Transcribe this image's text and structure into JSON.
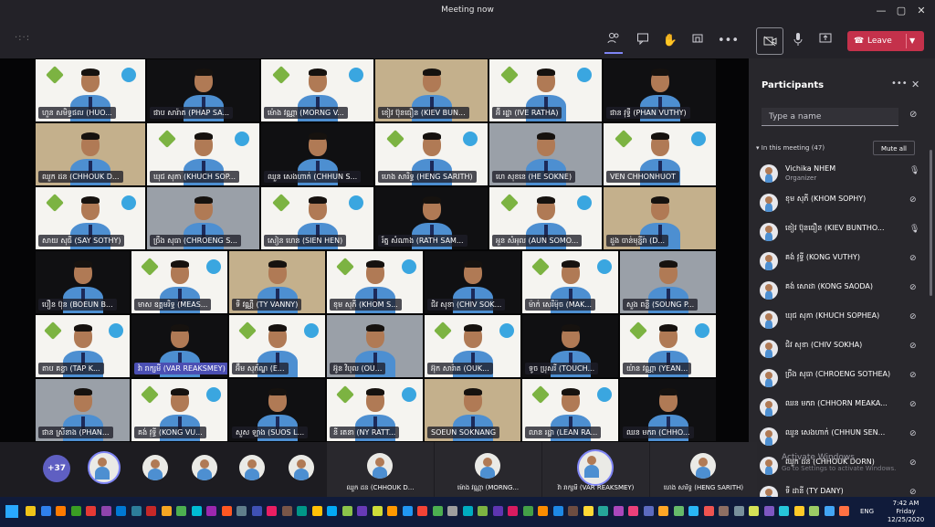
{
  "window": {
    "title": "Meeting now"
  },
  "toolbar": {
    "leave_label": "Leave"
  },
  "panel": {
    "title": "Participants",
    "search_placeholder": "Type a name",
    "section_label": "In this meeting (47)",
    "mute_all_label": "Mute all",
    "participants": [
      {
        "name": "Vichika NHEM",
        "role": "Organizer"
      },
      {
        "name": "ខុម សុភី (KHOM SOPHY)"
      },
      {
        "name": "ខៀវ ប៊ុនធឿន (KIEV BUNTHO..."
      },
      {
        "name": "គង់ វុទ្ធី (KONG VUTHY)"
      },
      {
        "name": "គង់ សោដា (KONG SAODA)"
      },
      {
        "name": "ឃុជ សុភា (KHUCH SOPHEA)"
      },
      {
        "name": "ជិវ សុខា (CHIV SOKHA)"
      },
      {
        "name": "ច្រឹង សុធា (CHROENG SOTHEA)"
      },
      {
        "name": "ឈន មករា (CHHORN MEAKA..."
      },
      {
        "name": "ឈួន សេងហាក់ (CHHUN SEN..."
      },
      {
        "name": "ឈួក ដន (CHHOUK DORN)"
      },
      {
        "name": "ទី ដានី (TY DANY)"
      }
    ]
  },
  "grid": {
    "tiles": [
      "ហួន សមិទ្ធផល (HUO...",
      "ផាប សារ៉ាត (PHAP SA...",
      "ម៉ោង វណ្ណា (MORNG V...",
      "ខៀវ ប៊ុនធឿន (KIEV BUN...",
      "អ៊ី រដ្ឋា (IVE RATHA)",
      "ផាន វុទ្ធី (PHAN VUTHY)",
      "ឈួក ដន (CHHOUK D...",
      "ឃុជ សុភា (KHUCH SOP...",
      "ឈួន សេងហាក់ (CHHUN S...",
      "ហេង សារិទ្ធ (HENG SARITH)",
      "ហេ សុខនេ (HE SOKNE)",
      "VEN CHHONHUOT",
      "សាយ សុធី (SAY SOTHY)",
      "ច្រឹង សុធា (CHROENG S...",
      "សៀន ហេន (SIEN HEN)",
      "រ័ត្ន សំណាង (RATH SAM...",
      "អួន សំអុល (AUN SOMO...",
      "ដួង ចាន់មុន្នីរ៉ា (D...",
      "បឿន ប៊ុន (BOEUN B...",
      "មាស ឧត្តមរិទ្ធ (MEAS...",
      "ទី វណ្ណី (TY VANNY)",
      "ខុម សុភី (KHOM S...",
      "ជិវ សុខា (CHIV SOK...",
      "ម៉ាក់ សេរីម៉ុច (MAK...",
      "សួង ពន្លឺ (SOUNG P...",
      "តាប គន្ធា (TAP K...",
      "វ៉ា រាក្សមី (VAR REAKSMEY)",
      "អ៊ឹម សុភ័ណ្ឌ (E...",
      "អ៊ូន វិបុល (OU...",
      "អ៊ុក សារ៉ាត (OUK...",
      "ទូច ប្រុសរី (TOUCH...",
      "យ៉ាន វណ្ណា (YEAN...",
      "ផាន ស្រីនាង (PHAN...",
      "គង់ វុទ្ធី (KONG VU...",
      "សួស ឡាង (SUOS L...",
      "នី រតនា (NY RATT...",
      "SOEUN SOKNANG",
      "លាន រដ្ឋា (LEAN RA...",
      "ឈន មករា (CHHO..."
    ]
  },
  "strip": {
    "overflow_count": "+37",
    "tiles": [
      "ឈួក ដន (CHHOUK D...",
      "ម៉ោង វណ្ណា (MORNG...",
      "វ៉ា រាក្សមី (VAR REAKSMEY)",
      "ហេង សារិទ្ធ (HENG SARITH)"
    ]
  },
  "watermark": {
    "line1": "Activate Windows",
    "line2": "Go to Settings to activate Windows."
  },
  "taskbar": {
    "lang": "ENG",
    "time": "7:42 AM",
    "day": "Friday",
    "date": "12/25/2020"
  },
  "colors": {
    "leave": "#c4314b",
    "accent": "#5f5fc2",
    "shirt": "#4d8fd1",
    "backdrop": "#f5f4f0"
  }
}
